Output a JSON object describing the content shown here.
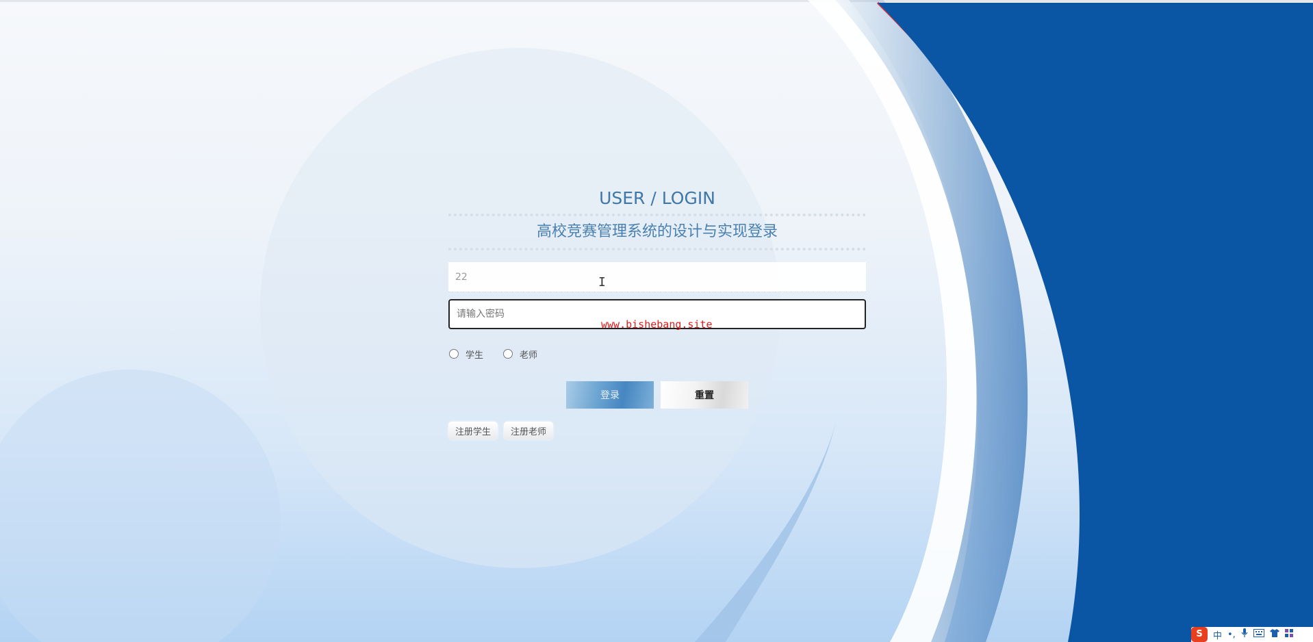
{
  "login": {
    "title": "USER / LOGIN",
    "subtitle": "高校竞赛管理系统的设计与实现登录",
    "username_value": "22",
    "password_placeholder": "请输入密码",
    "watermark": "www.bishebang.site",
    "roles": [
      {
        "label": "学生",
        "checked": false
      },
      {
        "label": "老师",
        "checked": false
      }
    ],
    "login_button": "登录",
    "reset_button": "重置",
    "register_student": "注册学生",
    "register_teacher": "注册老师"
  },
  "tray": {
    "ime_logo": "S",
    "lang": "中",
    "punct": "•,",
    "mic_icon": "mic-icon",
    "keyboard_icon": "keyboard-icon",
    "skin_icon": "shirt-icon",
    "grid_icon": "grid-icon"
  },
  "colors": {
    "right_panel": "#0a56a4",
    "accent_red": "#d8373a",
    "title_blue": "#3f78a8"
  }
}
